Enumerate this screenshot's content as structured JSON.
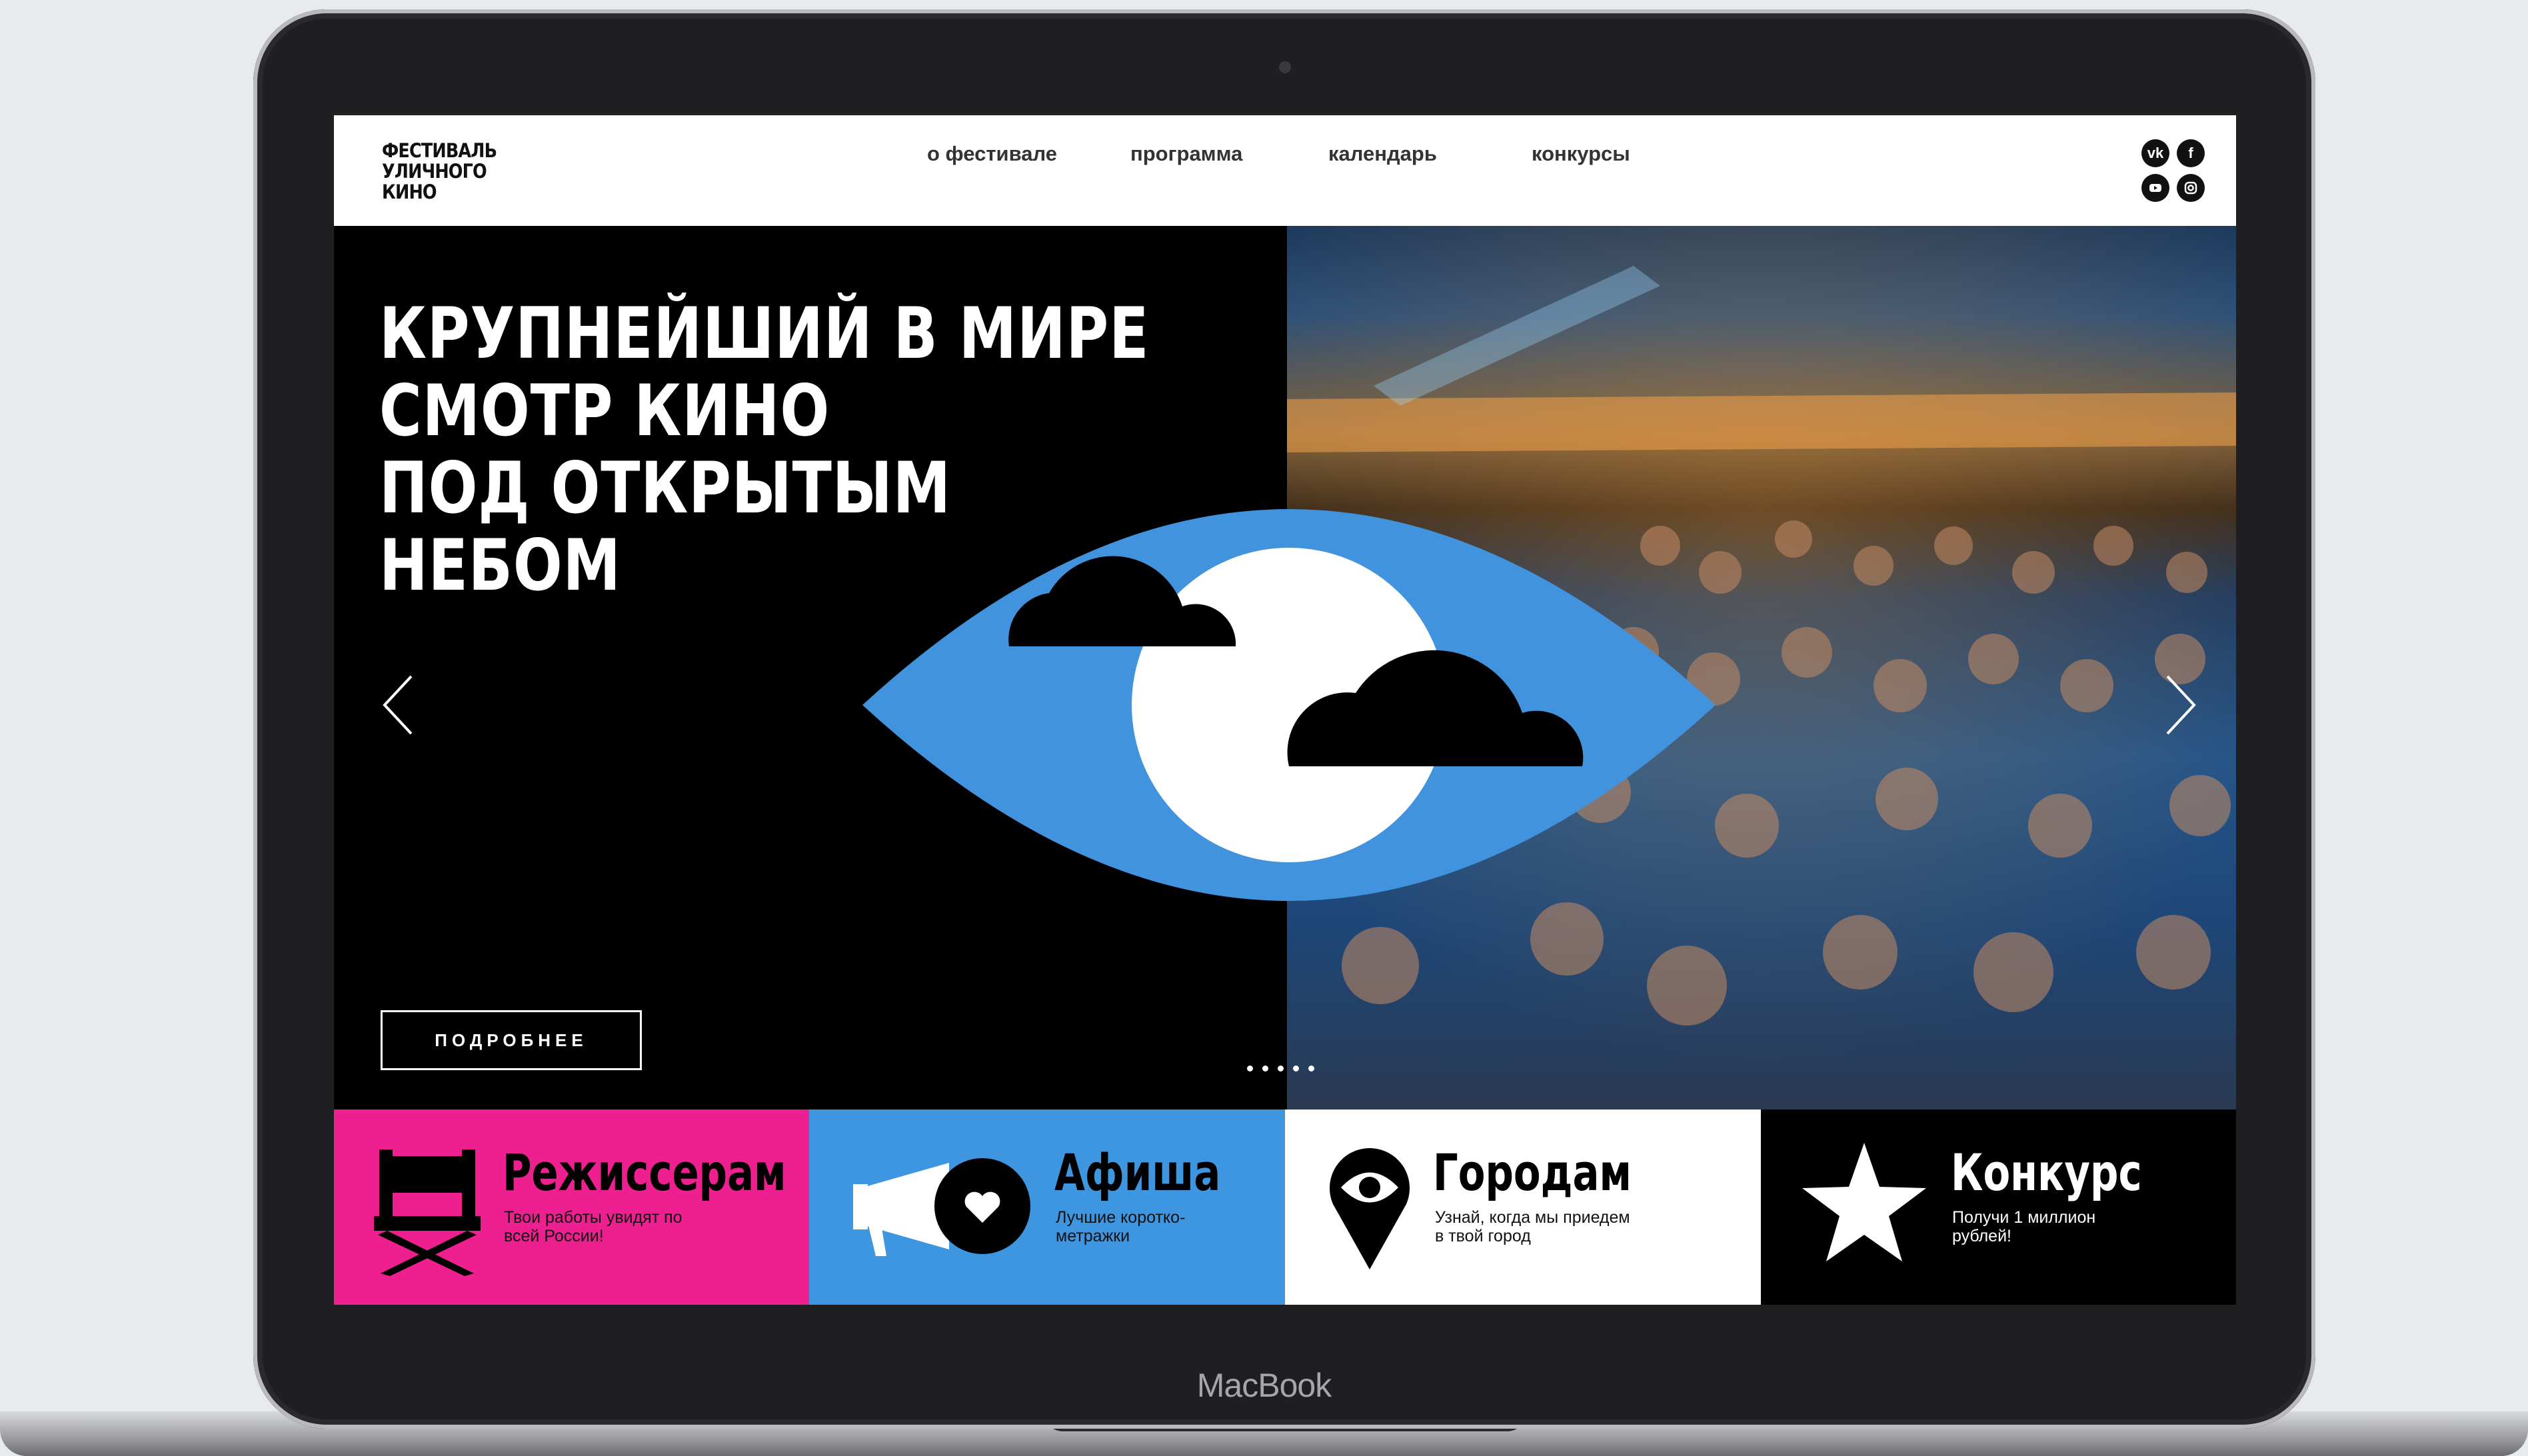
{
  "device": {
    "brand": "MacBook"
  },
  "header": {
    "logo_lines": [
      "ФЕСТИВАЛЬ",
      "УЛИЧНОГО",
      "КИНО"
    ],
    "nav": [
      "о фестивале",
      "программа",
      "календарь",
      "конкурсы"
    ],
    "social": [
      "vk-icon",
      "facebook-icon",
      "youtube-icon",
      "instagram-icon"
    ]
  },
  "hero": {
    "headline": [
      "КРУПНЕЙШИЙ В МИРЕ",
      "СМОТР КИНО",
      "ПОД ОТКРЫТЫМ",
      "НЕБОМ"
    ],
    "button": "ПОДРОБНЕЕ",
    "slide_count": 5
  },
  "tiles": [
    {
      "title": "Режиссерам",
      "subtitle": "Твои работы увидят по всей России!",
      "icon": "director-chair-icon",
      "bg": "#ee1f8f"
    },
    {
      "title": "Афиша",
      "subtitle": "Лучшие коротко- метражки",
      "icon": "megaphone-heart-icon",
      "bg": "#3f96e0"
    },
    {
      "title": "Городам",
      "subtitle": "Узнай, когда мы приедем в твой город",
      "icon": "map-pin-eye-icon",
      "bg": "#ffffff"
    },
    {
      "title": "Конкурс",
      "subtitle": "Получи 1 миллион рублей!",
      "icon": "star-icon",
      "bg": "#000000"
    }
  ],
  "colors": {
    "accent_pink": "#ee1f8f",
    "accent_blue": "#3f96e0",
    "eye_blue": "#4193de"
  }
}
